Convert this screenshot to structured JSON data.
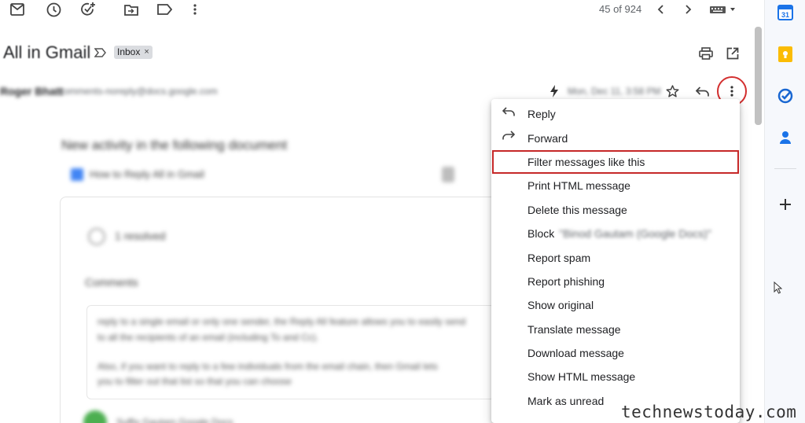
{
  "toolbar": {
    "pager": "45 of 924",
    "icons": [
      "archive-icon",
      "snooze-icon",
      "add-task-icon",
      "move-to-icon",
      "label-icon",
      "more-icon",
      "prev-icon",
      "next-icon",
      "keyboard-icon"
    ]
  },
  "email": {
    "subject": "All in Gmail",
    "label_chip": "Inbox",
    "label_chip_close": "×",
    "sender_name": "Roger Bhatt",
    "sender_email": "comments-noreply@docs.google.com",
    "date": "Mon, Dec 11, 3:58 PM",
    "body_heading": "New activity in the following document",
    "doc_name": "How to Reply All in Gmail",
    "resolved_text": "1 resolved",
    "comments_heading": "Comments",
    "comment_line1": "reply to a single email or only one sender, the Reply All feature allows you to easily send",
    "comment_line2": "to all the recipients of an email (including To and Cc).",
    "comment_line3": "Also, if you want to reply to a few individuals from the email chain, then Gmail lets",
    "comment_line4": "you to filter out that list so that you can choose",
    "commenter": "Suffix Gautam Google Docs"
  },
  "menu": {
    "items": [
      {
        "label": "Reply",
        "icon": "reply-icon"
      },
      {
        "label": "Forward",
        "icon": "forward-icon"
      },
      {
        "label": "Filter messages like this"
      },
      {
        "label": "Print HTML message"
      },
      {
        "label": "Delete this message"
      },
      {
        "label": "Block",
        "extra": "\"Binod Gautam (Google Docs)\""
      },
      {
        "label": "Report spam"
      },
      {
        "label": "Report phishing"
      },
      {
        "label": "Show original"
      },
      {
        "label": "Translate message"
      },
      {
        "label": "Download message"
      },
      {
        "label": "Show HTML message"
      },
      {
        "label": "Mark as unread"
      }
    ]
  },
  "side_rail": {
    "calendar_day": "31",
    "icons": [
      "calendar-icon",
      "keep-icon",
      "tasks-icon",
      "contacts-icon",
      "add-icon"
    ]
  },
  "colors": {
    "highlight": "#d32f2f",
    "calendar_blue": "#1a73e8",
    "keep_yellow": "#fbbc04",
    "tasks_blue": "#1967d2"
  },
  "watermark": "technewstoday.com"
}
